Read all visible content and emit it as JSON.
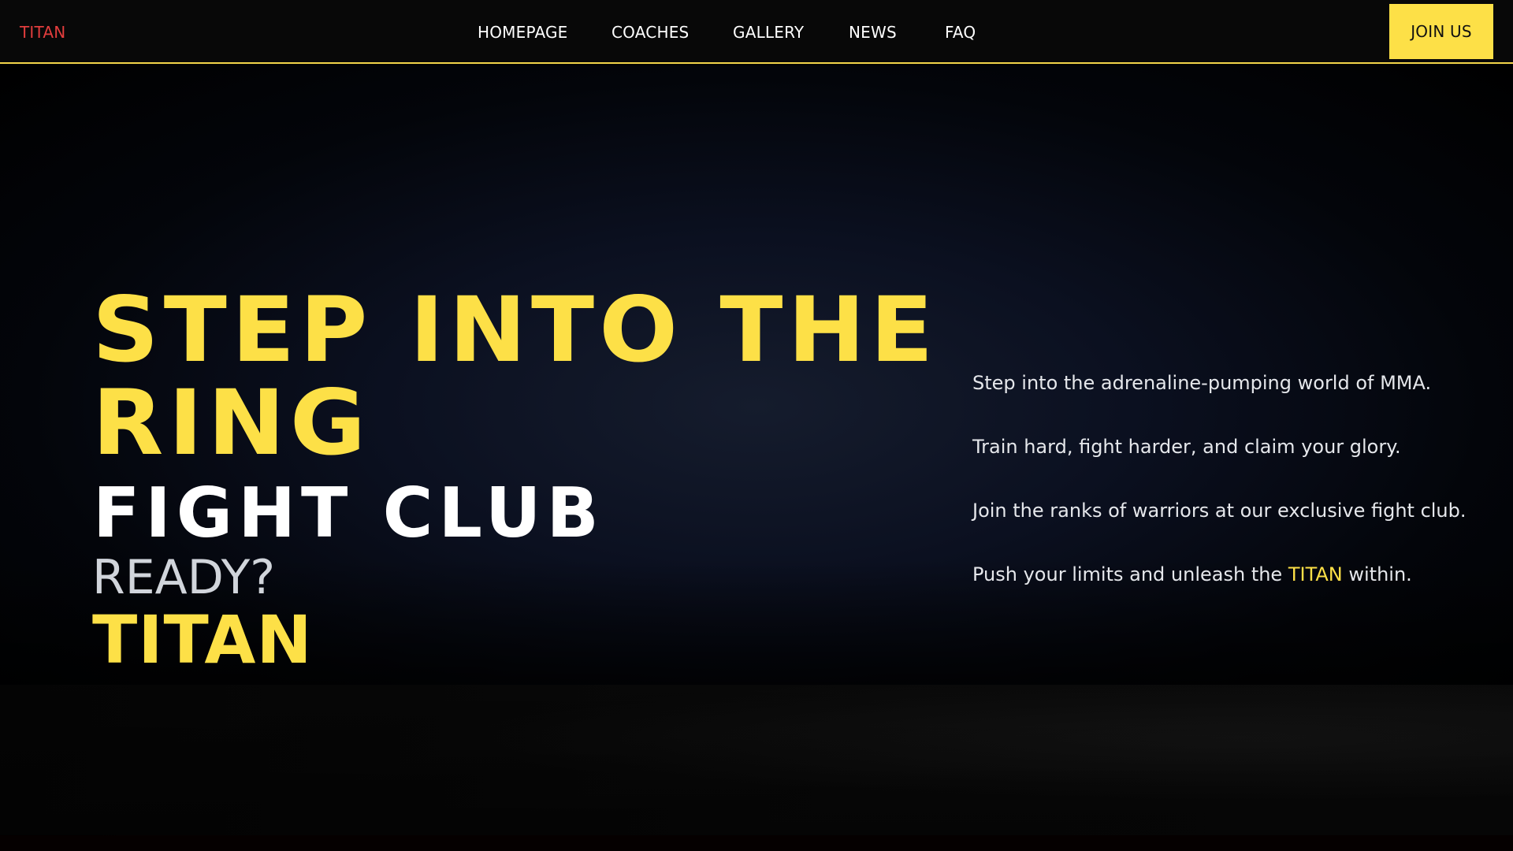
{
  "header": {
    "brand": "TITAN",
    "nav": {
      "homepage": "HOMEPAGE",
      "coaches": "COACHES",
      "gallery": "GALLERY",
      "news": "NEWS",
      "faq": "FAQ"
    },
    "cta": "JOIN US"
  },
  "hero": {
    "headline_line1": "STEP INTO THE",
    "headline_line2": "RING",
    "subheadline": "FIGHT CLUB",
    "prompt": "READY?",
    "brand_text": "TITAN",
    "taglines": {
      "line1": "Step into the adrenaline-pumping world of MMA.",
      "line2": "Train hard, fight harder, and claim your glory.",
      "line3": "Join the ranks of warriors at our exclusive fight club.",
      "line4_prefix": "Push your limits and unleash the ",
      "line4_accent": "TITAN",
      "line4_suffix": " within."
    }
  },
  "colors": {
    "accent_yellow": "#fde047",
    "brand_red": "#e23d3d",
    "text_white": "#ffffff",
    "text_gray": "#d1d5db",
    "background_dark": "#000000"
  }
}
